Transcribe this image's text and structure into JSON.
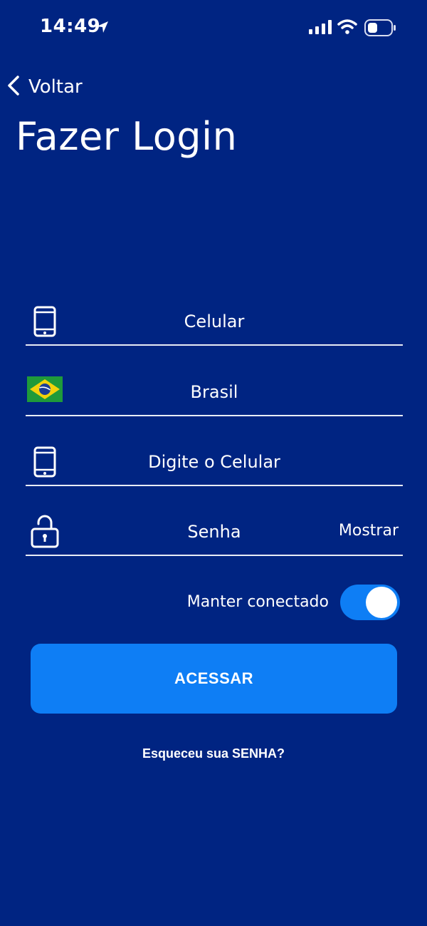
{
  "status_bar": {
    "time": "14:49",
    "icons": [
      "location-arrow-icon",
      "cellular-signal-icon",
      "wifi-icon",
      "battery-icon"
    ]
  },
  "nav": {
    "back_label": "Voltar",
    "back_icon": "chevron-left-icon"
  },
  "page": {
    "title": "Fazer Login"
  },
  "form": {
    "login_type": {
      "label": "Celular",
      "icon": "phone-icon"
    },
    "country": {
      "label": "Brasil",
      "icon": "brazil-flag-icon"
    },
    "phone": {
      "placeholder": "Digite o Celular",
      "icon": "phone-icon"
    },
    "password": {
      "placeholder": "Senha",
      "icon": "unlock-icon",
      "show_label": "Mostrar"
    },
    "keep_connected": {
      "label": "Manter conectado",
      "enabled": true
    },
    "submit_label": "ACESSAR",
    "forgot_label": "Esqueceu sua SENHA?"
  },
  "colors": {
    "background": "#002482",
    "accent": "#0e7ef5",
    "text": "#ffffff",
    "divider": "#e8ecf5"
  }
}
